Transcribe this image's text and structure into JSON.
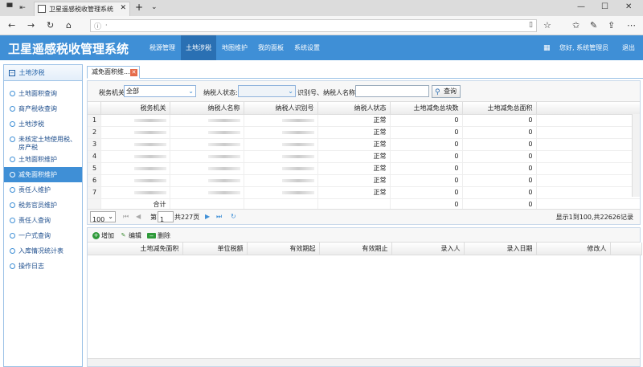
{
  "browser": {
    "tab_title": "卫星遥感税收管理系统",
    "url": "·"
  },
  "app": {
    "title": "卫星遥感税收管理系统",
    "nav": [
      "税源管理",
      "土地涉税",
      "地图维护",
      "我的面板",
      "系统设置"
    ],
    "greeting": "您好, 系统管理员",
    "logout": "退出"
  },
  "sidebar": {
    "header": "土地涉税",
    "items": [
      "土地面积查询",
      "商产税收查询",
      "土地涉税",
      "未核定土地使用税、房产税",
      "土地面积维护",
      "减免面积维护",
      "责任人维护",
      "税务官员维护",
      "责任人查询",
      "一户式查询",
      "入库情况统计表",
      "操作日志"
    ],
    "active_index": 5
  },
  "content_tab": {
    "label": "减免面积维..."
  },
  "filter": {
    "org_label": "税务机关",
    "org_value": "全部",
    "status_label": "纳税人状态:",
    "status_value": "",
    "id_label": "识别号、纳税人名称:",
    "id_value": "",
    "query_label": "查询"
  },
  "grid": {
    "columns": [
      "税务机关",
      "纳税人名称",
      "纳税人识别号",
      "纳税人状态",
      "土地减免总块数",
      "土地减免总面积"
    ],
    "rows": [
      {
        "n": "1",
        "status": "正常",
        "count": "0",
        "area": "0"
      },
      {
        "n": "2",
        "status": "正常",
        "count": "0",
        "area": "0"
      },
      {
        "n": "3",
        "status": "正常",
        "count": "0",
        "area": "0"
      },
      {
        "n": "4",
        "status": "正常",
        "count": "0",
        "area": "0"
      },
      {
        "n": "5",
        "status": "正常",
        "count": "0",
        "area": "0"
      },
      {
        "n": "6",
        "status": "正常",
        "count": "0",
        "area": "0"
      },
      {
        "n": "7",
        "status": "正常",
        "count": "0",
        "area": "0"
      }
    ],
    "total_label": "合计",
    "total_count": "0",
    "total_area": "0"
  },
  "pager": {
    "page_size": "100",
    "page_prefix": "第",
    "page": "1",
    "page_total": "共227页",
    "summary": "显示1到100,共22626记录"
  },
  "detail": {
    "buttons": [
      "增加",
      "编辑",
      "删除"
    ],
    "columns": [
      "土地减免面积",
      "单位税额",
      "有效期起",
      "有效期止",
      "录入人",
      "录入日期",
      "修改人"
    ]
  }
}
